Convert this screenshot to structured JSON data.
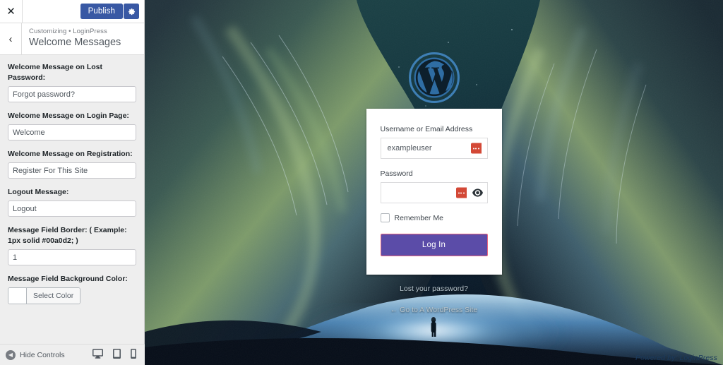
{
  "customizer": {
    "close_icon": "close-icon",
    "publish_label": "Publish",
    "gear_icon": "gear-icon",
    "back_icon": "chevron-left-icon",
    "breadcrumb": "Customizing • LoginPress",
    "panel_title": "Welcome Messages",
    "accent_color": "#3858a4",
    "controls": [
      {
        "label": "Welcome Message on Lost Password:",
        "value": "Forgot password?",
        "type": "text"
      },
      {
        "label": "Welcome Message on Login Page:",
        "value": "Welcome",
        "type": "text"
      },
      {
        "label": "Welcome Message on Registration:",
        "value": "Register For This Site",
        "type": "text"
      },
      {
        "label": "Logout Message:",
        "value": "Logout",
        "type": "text"
      },
      {
        "label": "Message Field Border: ( Example: 1px solid #00a0d2; )",
        "value": "1",
        "type": "text"
      },
      {
        "label": "Message Field Background Color:",
        "value": "",
        "type": "color",
        "button_label": "Select Color",
        "swatch_color": "#ffffff"
      }
    ],
    "footer": {
      "hide_controls_label": "Hide Controls",
      "hide_controls_icon": "collapse-arrow-icon",
      "devices": [
        {
          "name": "desktop",
          "icon": "desktop-icon",
          "active": true
        },
        {
          "name": "tablet",
          "icon": "tablet-icon",
          "active": false
        },
        {
          "name": "mobile",
          "icon": "mobile-icon",
          "active": false
        }
      ]
    }
  },
  "preview": {
    "logo_icon": "wordpress-logo-icon",
    "form": {
      "username_label": "Username or Email Address",
      "username_value": "exampleuser",
      "username_autofill_icon": "lastpass-icon",
      "password_label": "Password",
      "password_value": "",
      "password_autofill_icon": "lastpass-icon",
      "password_toggle_icon": "eye-icon",
      "remember_label": "Remember Me",
      "remember_checked": false,
      "submit_label": "Log In",
      "submit_bg": "#5b4ca8",
      "submit_border": "#e8677f"
    },
    "lost_password_label": "Lost your password?",
    "back_to_site_label": "← Go to A WordPress Site",
    "powered_by_label": "Powered by: LoginPress"
  }
}
